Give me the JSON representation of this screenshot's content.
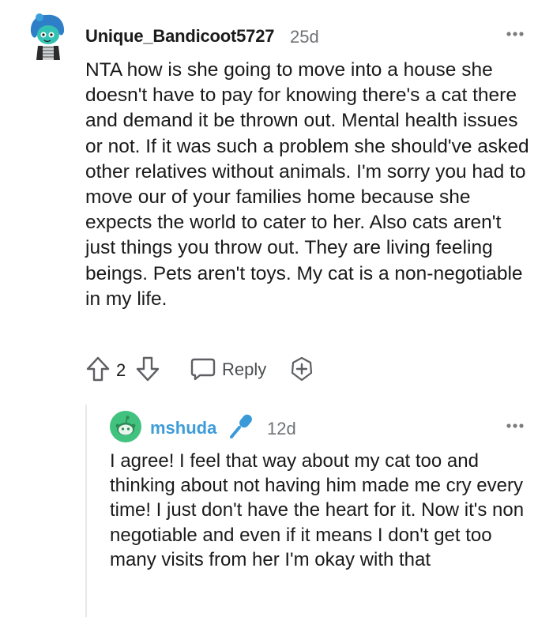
{
  "comment": {
    "username": "Unique_Bandicoot5727",
    "time": "25d",
    "body": "NTA how is she going to move into a house she doesn't have to pay for knowing there's a cat there and demand it be thrown out. Mental health issues or not. If it was such a problem she should've asked other relatives without animals. I'm sorry you had to move our of your families home because she expects the world to cater to her. Also cats aren't just things you throw out. They are living feeling beings. Pets aren't toys. My cat is a non-negotiable in my life.",
    "score": "2",
    "reply_label": "Reply"
  },
  "reply": {
    "username": "mshuda",
    "time": "12d",
    "body": "I agree! I feel that way about my cat too and thinking about not having him made me cry every time! I just don't have the heart for it. Now it's non negotiable and even if it means I don't get too many visits from her I'm okay with that"
  },
  "colors": {
    "username_reply": "#3e9cd8",
    "meta_gray": "#6f7275",
    "avatar2_bg": "#41c27f"
  },
  "icons": [
    "snoo-avatar-icon",
    "more-options-icon",
    "upvote-icon",
    "downvote-icon",
    "reply-bubble-icon",
    "award-plus-icon",
    "microphone-icon"
  ]
}
